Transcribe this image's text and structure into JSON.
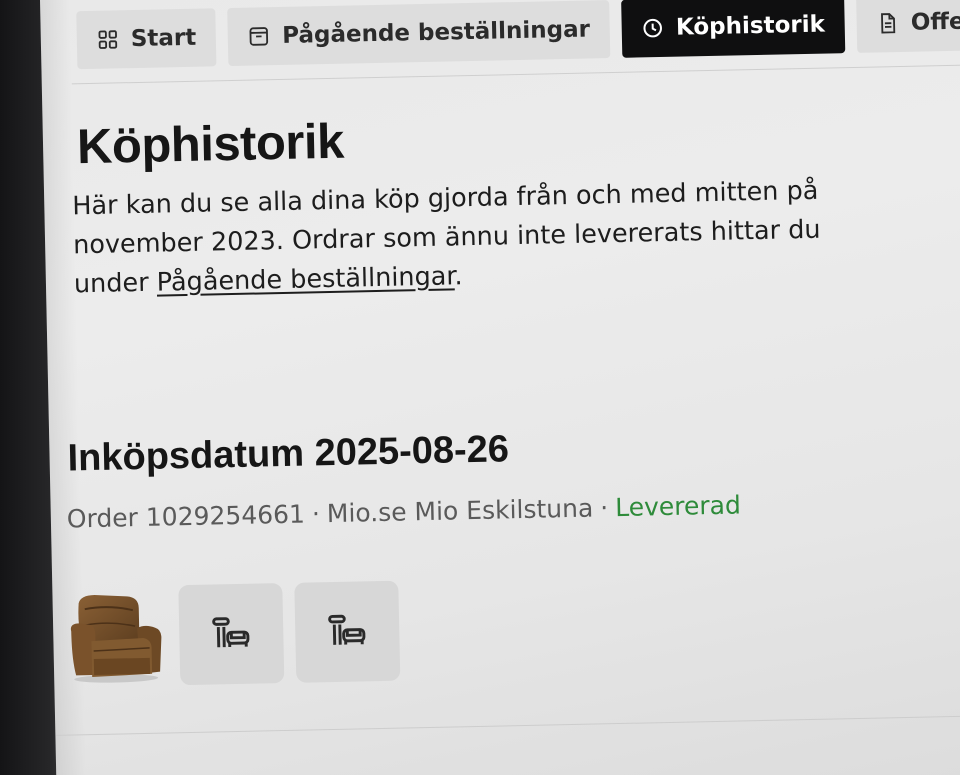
{
  "nav": {
    "tabs": [
      {
        "label": "Start",
        "icon": "grid-icon",
        "active": false
      },
      {
        "label": "Pågående beställningar",
        "icon": "package-icon",
        "active": false
      },
      {
        "label": "Köphistorik",
        "icon": "clock-icon",
        "active": true
      },
      {
        "label": "Offe",
        "icon": "document-icon",
        "active": false
      }
    ]
  },
  "page": {
    "title": "Köphistorik",
    "intro_text": "Här kan du se alla dina köp gjorda från och med mitten på november 2023. Ordrar som ännu inte levererats hittar du under ",
    "intro_link": "Pågående beställningar",
    "intro_end": "."
  },
  "order": {
    "date_heading": "Inköpsdatum 2025-08-26",
    "order_label": "Order 1029254661",
    "separator": "·",
    "store": "Mio.se Mio Eskilstuna",
    "status": "Levererad",
    "status_color": "#2e8b3a",
    "items": [
      {
        "type": "photo",
        "icon": "armchair-photo"
      },
      {
        "type": "placeholder",
        "icon": "armchair-placeholder-icon"
      },
      {
        "type": "placeholder",
        "icon": "armchair-placeholder-icon"
      }
    ]
  }
}
